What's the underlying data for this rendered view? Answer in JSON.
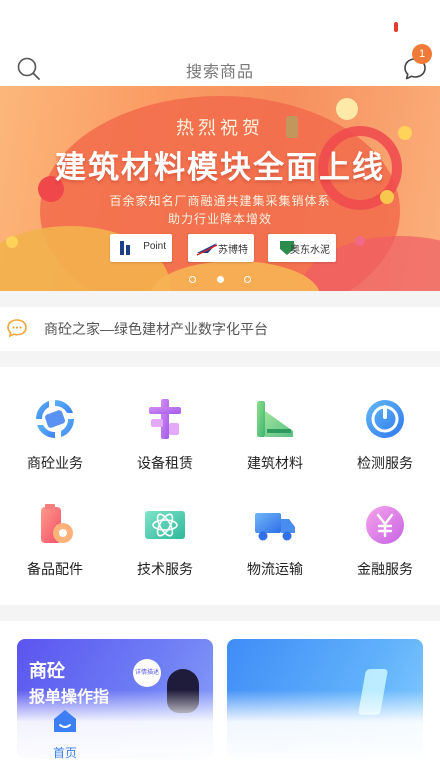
{
  "header": {
    "search_placeholder": "搜索商品",
    "message_badge_count": "1"
  },
  "banner": {
    "subtitle": "热烈祝贺",
    "title": "建筑材料模块全面上线",
    "line1": "百余家知名厂商融通共建集采集销体系",
    "line2": "助力行业降本增效",
    "logos": [
      {
        "text": "Point"
      },
      {
        "text": "苏博特"
      },
      {
        "text": "奥东水泥"
      }
    ],
    "page_count": 3,
    "active_page": 2
  },
  "notice": {
    "text": "商砼之家—绿色建材产业数字化平台"
  },
  "services": [
    {
      "label": "商砼业务",
      "icon": "concrete-business-icon"
    },
    {
      "label": "设备租赁",
      "icon": "equipment-rental-icon"
    },
    {
      "label": "建筑材料",
      "icon": "building-materials-icon"
    },
    {
      "label": "检测服务",
      "icon": "testing-service-icon"
    },
    {
      "label": "备品配件",
      "icon": "spare-parts-icon"
    },
    {
      "label": "技术服务",
      "icon": "tech-service-icon"
    },
    {
      "label": "物流运输",
      "icon": "logistics-icon"
    },
    {
      "label": "金融服务",
      "icon": "finance-icon"
    }
  ],
  "cards": {
    "card1_title": "商砼",
    "card1_subtitle": "报单操作指",
    "card1_bubble": "详情描述"
  },
  "tabbar": {
    "home_label": "首页"
  },
  "colors": {
    "accent": "#3d7ff2",
    "badge": "#f07a37",
    "banner": "#f68f5d"
  }
}
